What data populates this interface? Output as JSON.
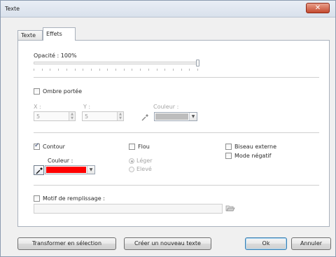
{
  "window": {
    "title": "Texte",
    "close_glyph": "✕"
  },
  "tabs": [
    {
      "label": "Texte",
      "active": false
    },
    {
      "label": "Effets",
      "active": true
    }
  ],
  "opacity": {
    "label": "Opacité : 100%",
    "value_percent": 100
  },
  "shadow": {
    "checkbox_label": "Ombre portée",
    "checked": false,
    "x_label": "X :",
    "x_value": "5",
    "y_label": "Y :",
    "y_value": "5",
    "color_label": "Couleur :",
    "color": "#bdbdbd"
  },
  "contour": {
    "checkbox_label": "Contour",
    "checked": true,
    "color_label": "Couleur :",
    "color": "#ff0000"
  },
  "blur": {
    "checkbox_label": "Flou",
    "checked": false,
    "options": [
      {
        "label": "Léger",
        "selected": true
      },
      {
        "label": "Elevé",
        "selected": false
      }
    ]
  },
  "bevel": {
    "checkbox_label": "Biseau externe",
    "checked": false
  },
  "negative": {
    "checkbox_label": "Mode négatif",
    "checked": false
  },
  "fill_pattern": {
    "checkbox_label": "Motif de remplissage :",
    "checked": false,
    "path_value": ""
  },
  "buttons": {
    "transform": "Transformer en sélection",
    "create": "Créer un nouveau texte",
    "ok": "Ok",
    "cancel": "Annuler"
  },
  "icons": {
    "close": "close-icon",
    "eyedropper": "eyedropper-icon",
    "folder": "folder-open-icon",
    "dropdown": "chevron-down-icon",
    "spin_up": "spin-up-icon",
    "spin_down": "spin-down-icon"
  }
}
